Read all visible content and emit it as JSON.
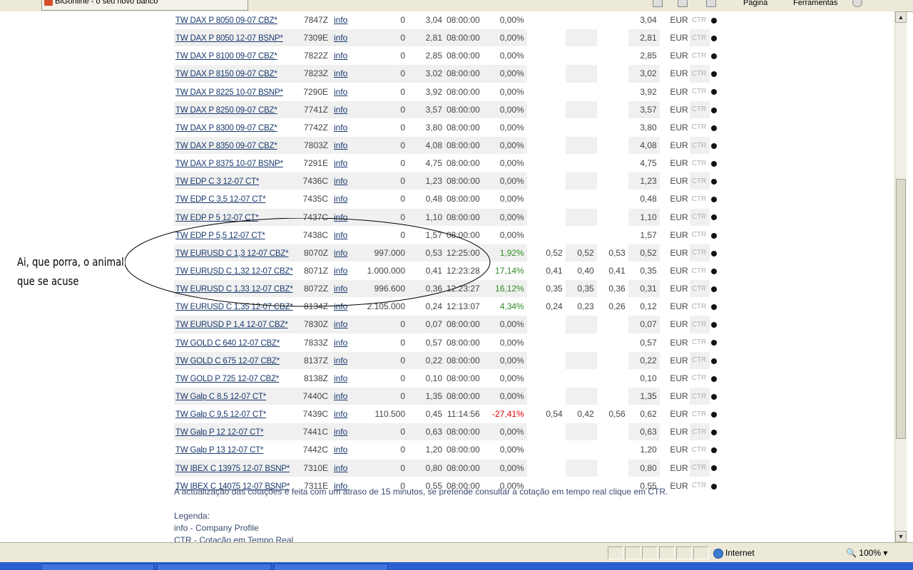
{
  "browser": {
    "tab_title": "BiGonline - o seu novo banco",
    "toolbar_page": "Página",
    "toolbar_tools": "Ferramentas"
  },
  "quotes": [
    {
      "name": "TW DAX P 8050 09-07 CBZ*",
      "code": "7847Z",
      "info": "info",
      "vol": "0",
      "last": "3,04",
      "time": "08:00:00",
      "var": "0,00%",
      "var_class": "neutral",
      "buy": "",
      "sell": "",
      "open": "",
      "close": "3,04",
      "cur": "EUR",
      "ctr": "CTR"
    },
    {
      "name": "TW DAX P 8050 12-07 BSNP*",
      "code": "7309E",
      "info": "info",
      "vol": "0",
      "last": "2,81",
      "time": "08:00:00",
      "var": "0,00%",
      "var_class": "neutral",
      "buy": "",
      "sell": "",
      "open": "",
      "close": "2,81",
      "cur": "EUR",
      "ctr": "CTR"
    },
    {
      "name": "TW DAX P 8100 09-07 CBZ*",
      "code": "7822Z",
      "info": "info",
      "vol": "0",
      "last": "2,85",
      "time": "08:00:00",
      "var": "0,00%",
      "var_class": "neutral",
      "buy": "",
      "sell": "",
      "open": "",
      "close": "2,85",
      "cur": "EUR",
      "ctr": "CTR"
    },
    {
      "name": "TW DAX P 8150 09-07 CBZ*",
      "code": "7823Z",
      "info": "info",
      "vol": "0",
      "last": "3,02",
      "time": "08:00:00",
      "var": "0,00%",
      "var_class": "neutral",
      "buy": "",
      "sell": "",
      "open": "",
      "close": "3,02",
      "cur": "EUR",
      "ctr": "CTR"
    },
    {
      "name": "TW DAX P 8225 10-07 BSNP*",
      "code": "7290E",
      "info": "info",
      "vol": "0",
      "last": "3,92",
      "time": "08:00:00",
      "var": "0,00%",
      "var_class": "neutral",
      "buy": "",
      "sell": "",
      "open": "",
      "close": "3,92",
      "cur": "EUR",
      "ctr": "CTR"
    },
    {
      "name": "TW DAX P 8250 09-07 CBZ*",
      "code": "7741Z",
      "info": "info",
      "vol": "0",
      "last": "3,57",
      "time": "08:00:00",
      "var": "0,00%",
      "var_class": "neutral",
      "buy": "",
      "sell": "",
      "open": "",
      "close": "3,57",
      "cur": "EUR",
      "ctr": "CTR"
    },
    {
      "name": "TW DAX P 8300 09-07 CBZ*",
      "code": "7742Z",
      "info": "info",
      "vol": "0",
      "last": "3,80",
      "time": "08:00:00",
      "var": "0,00%",
      "var_class": "neutral",
      "buy": "",
      "sell": "",
      "open": "",
      "close": "3,80",
      "cur": "EUR",
      "ctr": "CTR"
    },
    {
      "name": "TW DAX P 8350 09-07 CBZ*",
      "code": "7803Z",
      "info": "info",
      "vol": "0",
      "last": "4,08",
      "time": "08:00:00",
      "var": "0,00%",
      "var_class": "neutral",
      "buy": "",
      "sell": "",
      "open": "",
      "close": "4,08",
      "cur": "EUR",
      "ctr": "CTR"
    },
    {
      "name": "TW DAX P 8375 10-07 BSNP*",
      "code": "7291E",
      "info": "info",
      "vol": "0",
      "last": "4,75",
      "time": "08:00:00",
      "var": "0,00%",
      "var_class": "neutral",
      "buy": "",
      "sell": "",
      "open": "",
      "close": "4,75",
      "cur": "EUR",
      "ctr": "CTR"
    },
    {
      "name": "TW EDP C 3 12-07 CT*",
      "code": "7436C",
      "info": "info",
      "vol": "0",
      "last": "1,23",
      "time": "08:00:00",
      "var": "0,00%",
      "var_class": "neutral",
      "buy": "",
      "sell": "",
      "open": "",
      "close": "1,23",
      "cur": "EUR",
      "ctr": "CTR"
    },
    {
      "name": "TW EDP C 3,5 12-07 CT*",
      "code": "7435C",
      "info": "info",
      "vol": "0",
      "last": "0,48",
      "time": "08:00:00",
      "var": "0,00%",
      "var_class": "neutral",
      "buy": "",
      "sell": "",
      "open": "",
      "close": "0,48",
      "cur": "EUR",
      "ctr": "CTR"
    },
    {
      "name": "TW EDP P 5 12-07 CT*",
      "code": "7437C",
      "info": "info",
      "vol": "0",
      "last": "1,10",
      "time": "08:00:00",
      "var": "0,00%",
      "var_class": "neutral",
      "buy": "",
      "sell": "",
      "open": "",
      "close": "1,10",
      "cur": "EUR",
      "ctr": "CTR"
    },
    {
      "name": "TW EDP P 5,5 12-07 CT*",
      "code": "7438C",
      "info": "info",
      "vol": "0",
      "last": "1,57",
      "time": "08:00:00",
      "var": "0,00%",
      "var_class": "neutral",
      "buy": "",
      "sell": "",
      "open": "",
      "close": "1,57",
      "cur": "EUR",
      "ctr": "CTR"
    },
    {
      "name": "TW EURUSD C 1,3 12-07 CBZ*",
      "code": "8070Z",
      "info": "info",
      "vol": "997.000",
      "last": "0,53",
      "time": "12:25:00",
      "var": "1,92%",
      "var_class": "pos",
      "buy": "0,52",
      "sell": "0,52",
      "open": "0,53",
      "close": "0,52",
      "cur": "EUR",
      "ctr": "CTR"
    },
    {
      "name": "TW EURUSD C 1,32 12-07 CBZ*",
      "code": "8071Z",
      "info": "info",
      "vol": "1.000.000",
      "last": "0,41",
      "time": "12:23:28",
      "var": "17,14%",
      "var_class": "pos",
      "buy": "0,41",
      "sell": "0,40",
      "open": "0,41",
      "close": "0,35",
      "cur": "EUR",
      "ctr": "CTR"
    },
    {
      "name": "TW EURUSD C 1,33 12-07 CBZ*",
      "code": "8072Z",
      "info": "info",
      "vol": "996.600",
      "last": "0,36",
      "time": "12:23:27",
      "var": "16,12%",
      "var_class": "pos",
      "buy": "0,35",
      "sell": "0,35",
      "open": "0,36",
      "close": "0,31",
      "cur": "EUR",
      "ctr": "CTR"
    },
    {
      "name": "TW EURUSD C 1,35 12-07 CBZ*",
      "code": "8134Z",
      "info": "info",
      "vol": "2.105.000",
      "last": "0,24",
      "time": "12:13:07",
      "var": "4,34%",
      "var_class": "pos",
      "buy": "0,24",
      "sell": "0,23",
      "open": "0,26",
      "close": "0,12",
      "cur": "EUR",
      "ctr": "CTR"
    },
    {
      "name": "TW EURUSD P 1,4 12-07 CBZ*",
      "code": "7830Z",
      "info": "info",
      "vol": "0",
      "last": "0,07",
      "time": "08:00:00",
      "var": "0,00%",
      "var_class": "neutral",
      "buy": "",
      "sell": "",
      "open": "",
      "close": "0,07",
      "cur": "EUR",
      "ctr": "CTR"
    },
    {
      "name": "TW GOLD C 640 12-07 CBZ*",
      "code": "7833Z",
      "info": "info",
      "vol": "0",
      "last": "0,57",
      "time": "08:00:00",
      "var": "0,00%",
      "var_class": "neutral",
      "buy": "",
      "sell": "",
      "open": "",
      "close": "0,57",
      "cur": "EUR",
      "ctr": "CTR"
    },
    {
      "name": "TW GOLD C 675 12-07 CBZ*",
      "code": "8137Z",
      "info": "info",
      "vol": "0",
      "last": "0,22",
      "time": "08:00:00",
      "var": "0,00%",
      "var_class": "neutral",
      "buy": "",
      "sell": "",
      "open": "",
      "close": "0,22",
      "cur": "EUR",
      "ctr": "CTR"
    },
    {
      "name": "TW GOLD P 725 12-07 CBZ*",
      "code": "8138Z",
      "info": "info",
      "vol": "0",
      "last": "0,10",
      "time": "08:00:00",
      "var": "0,00%",
      "var_class": "neutral",
      "buy": "",
      "sell": "",
      "open": "",
      "close": "0,10",
      "cur": "EUR",
      "ctr": "CTR"
    },
    {
      "name": "TW Galp C 8,5 12-07 CT*",
      "code": "7440C",
      "info": "info",
      "vol": "0",
      "last": "1,35",
      "time": "08:00:00",
      "var": "0,00%",
      "var_class": "neutral",
      "buy": "",
      "sell": "",
      "open": "",
      "close": "1,35",
      "cur": "EUR",
      "ctr": "CTR"
    },
    {
      "name": "TW Galp C 9,5 12-07 CT*",
      "code": "7439C",
      "info": "info",
      "vol": "110.500",
      "last": "0,45",
      "time": "11:14:56",
      "var": "-27,41%",
      "var_class": "neg",
      "buy": "0,54",
      "sell": "0,42",
      "open": "0,56",
      "close": "0,62",
      "cur": "EUR",
      "ctr": "CTR"
    },
    {
      "name": "TW Galp P 12 12-07 CT*",
      "code": "7441C",
      "info": "info",
      "vol": "0",
      "last": "0,63",
      "time": "08:00:00",
      "var": "0,00%",
      "var_class": "neutral",
      "buy": "",
      "sell": "",
      "open": "",
      "close": "0,63",
      "cur": "EUR",
      "ctr": "CTR"
    },
    {
      "name": "TW Galp P 13 12-07 CT*",
      "code": "7442C",
      "info": "info",
      "vol": "0",
      "last": "1,20",
      "time": "08:00:00",
      "var": "0,00%",
      "var_class": "neutral",
      "buy": "",
      "sell": "",
      "open": "",
      "close": "1,20",
      "cur": "EUR",
      "ctr": "CTR"
    },
    {
      "name": "TW IBEX C 13975 12-07 BSNP*",
      "code": "7310E",
      "info": "info",
      "vol": "0",
      "last": "0,80",
      "time": "08:00:00",
      "var": "0,00%",
      "var_class": "neutral",
      "buy": "",
      "sell": "",
      "open": "",
      "close": "0,80",
      "cur": "EUR",
      "ctr": "CTR"
    },
    {
      "name": "TW IBEX C 14075 12-07 BSNP*",
      "code": "7311E",
      "info": "info",
      "vol": "0",
      "last": "0,55",
      "time": "08:00:00",
      "var": "0,00%",
      "var_class": "neutral",
      "buy": "",
      "sell": "",
      "open": "",
      "close": "0,55",
      "cur": "EUR",
      "ctr": "CTR"
    }
  ],
  "footer": {
    "note": "A actualização das cotações é feita com um atraso de 15 minutos, se pretende consultar a cotação em tempo real clique em CTR.",
    "legend_title": "Legenda:",
    "legend_info": "info - Company Profile",
    "legend_ctr": "CTR - Cotação em Tempo Real"
  },
  "annotation": {
    "line1": "Ai, que porra, o animal",
    "line2": "que se acuse"
  },
  "status": {
    "zone": "Internet",
    "zoom": "100%"
  },
  "colors": {
    "positive": "#2e8b22",
    "negative": "#e00000",
    "link": "#1a3a6e",
    "row_shade": "#f0f0f0"
  }
}
